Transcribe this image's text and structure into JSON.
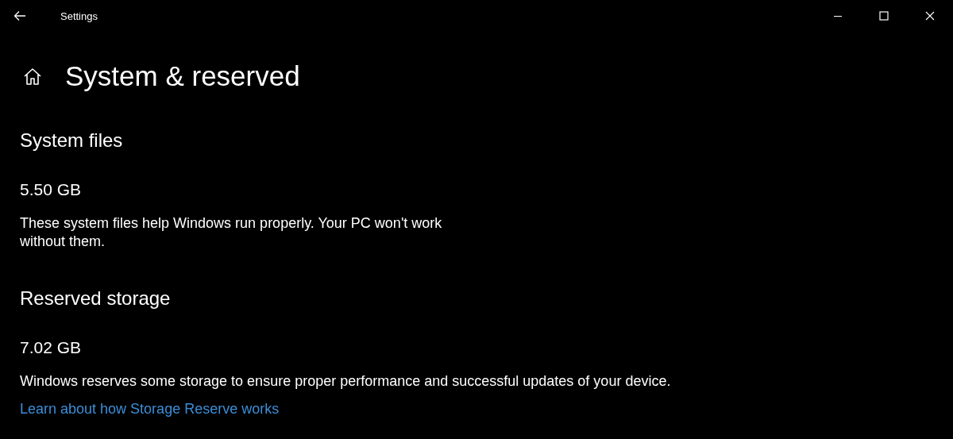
{
  "window": {
    "title": "Settings"
  },
  "page_title": "System & reserved",
  "sections": [
    {
      "heading": "System files",
      "size": "5.50 GB",
      "description": "These system files help Windows run properly. Your PC won't work without them."
    },
    {
      "heading": "Reserved storage",
      "size": "7.02 GB",
      "description": "Windows reserves some storage to ensure proper performance and successful updates of your device.",
      "link": "Learn about how Storage Reserve works"
    }
  ]
}
